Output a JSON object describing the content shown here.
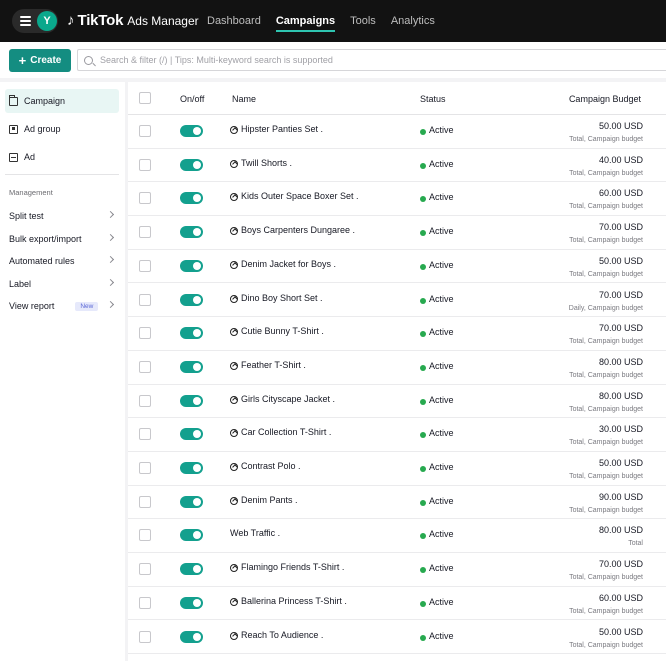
{
  "topbar": {
    "avatar_letter": "Y",
    "brand_name": "TikTok",
    "brand_sub": "Ads Manager",
    "nav": [
      "Dashboard",
      "Campaigns",
      "Tools",
      "Analytics"
    ]
  },
  "toolbar": {
    "create_label": "Create",
    "search_placeholder": "Search & filter (/) | Tips: Multi-keyword search is supported"
  },
  "sidebar": {
    "levels": [
      "Campaign",
      "Ad group",
      "Ad"
    ],
    "section": "Management",
    "management": [
      "Split test",
      "Bulk export/import",
      "Automated rules",
      "Label",
      "View report"
    ],
    "new_badge": "New"
  },
  "table": {
    "headers": {
      "onoff": "On/off",
      "name": "Name",
      "status": "Status",
      "budget": "Campaign Budget"
    },
    "rows": [
      {
        "name": "Hipster Panties Set .",
        "status": "Active",
        "budget": "50.00 USD",
        "budget_type": "Total, Campaign budget",
        "icon": true
      },
      {
        "name": "Twill Shorts .",
        "status": "Active",
        "budget": "40.00 USD",
        "budget_type": "Total, Campaign budget",
        "icon": true
      },
      {
        "name": "Kids Outer Space Boxer Set .",
        "status": "Active",
        "budget": "60.00 USD",
        "budget_type": "Total, Campaign budget",
        "icon": true
      },
      {
        "name": "Boys Carpenters Dungaree .",
        "status": "Active",
        "budget": "70.00 USD",
        "budget_type": "Total, Campaign budget",
        "icon": true
      },
      {
        "name": "Denim Jacket for Boys .",
        "status": "Active",
        "budget": "50.00 USD",
        "budget_type": "Total, Campaign budget",
        "icon": true
      },
      {
        "name": "Dino Boy Short Set .",
        "status": "Active",
        "budget": "70.00 USD",
        "budget_type": "Daily, Campaign budget",
        "icon": true
      },
      {
        "name": "Cutie Bunny T-Shirt .",
        "status": "Active",
        "budget": "70.00 USD",
        "budget_type": "Total, Campaign budget",
        "icon": true
      },
      {
        "name": "Feather T-Shirt .",
        "status": "Active",
        "budget": "80.00 USD",
        "budget_type": "Total, Campaign budget",
        "icon": true
      },
      {
        "name": "Girls Cityscape Jacket .",
        "status": "Active",
        "budget": "80.00 USD",
        "budget_type": "Total, Campaign budget",
        "icon": true
      },
      {
        "name": "Car Collection T-Shirt .",
        "status": "Active",
        "budget": "30.00 USD",
        "budget_type": "Total, Campaign budget",
        "icon": true
      },
      {
        "name": "Contrast Polo .",
        "status": "Active",
        "budget": "50.00 USD",
        "budget_type": "Total, Campaign budget",
        "icon": true
      },
      {
        "name": "Denim Pants .",
        "status": "Active",
        "budget": "90.00 USD",
        "budget_type": "Total, Campaign budget",
        "icon": true
      },
      {
        "name": "Web Traffic .",
        "status": "Active",
        "budget": "80.00 USD",
        "budget_type": "Total",
        "icon": false
      },
      {
        "name": "Flamingo Friends T-Shirt .",
        "status": "Active",
        "budget": "70.00 USD",
        "budget_type": "Total, Campaign budget",
        "icon": true
      },
      {
        "name": "Ballerina Princess T-Shirt .",
        "status": "Active",
        "budget": "60.00 USD",
        "budget_type": "Total, Campaign budget",
        "icon": true
      },
      {
        "name": "Reach To Audience .",
        "status": "Active",
        "budget": "50.00 USD",
        "budget_type": "Total, Campaign budget",
        "icon": true
      }
    ]
  },
  "colors": {
    "accent": "#148d81",
    "toggle_on": "#13a08e",
    "status_active": "#27a94f",
    "topbar_bg": "#121212"
  }
}
